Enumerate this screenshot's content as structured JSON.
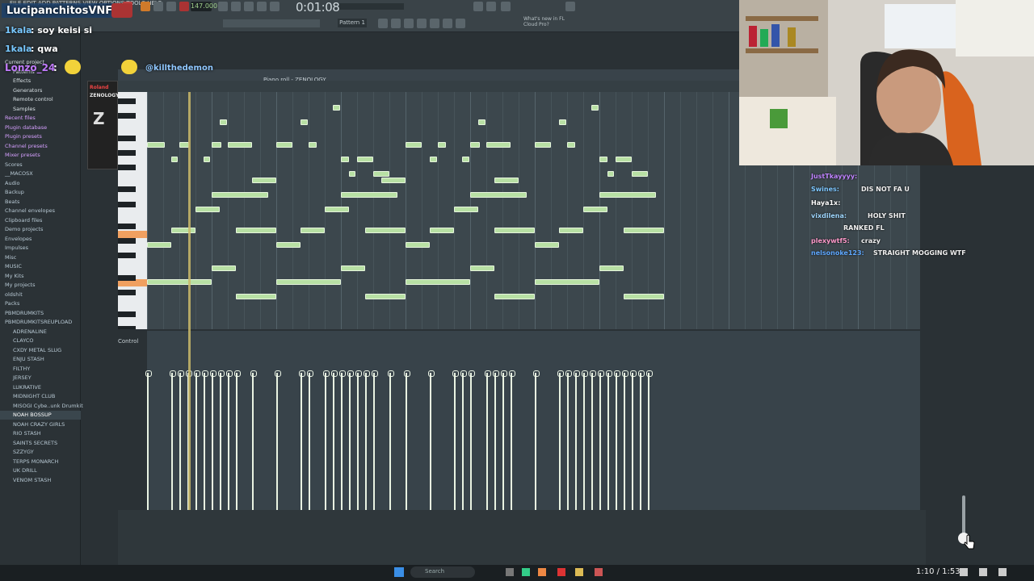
{
  "stream": {
    "streamer_label": "LucipanchitosVNF :",
    "chat_top": [
      {
        "user": "1kala",
        "message": ": soy keisi si"
      },
      {
        "user": "1kala",
        "message": ": qwa"
      },
      {
        "user": "Lonzo_24",
        "message": ":"
      }
    ],
    "mention": "@killthedemon",
    "chat_right": [
      {
        "user": "JustTkayyyy:",
        "message": ""
      },
      {
        "user": "Swines:",
        "message": "DIS NOT FA U"
      },
      {
        "user": "Haya1x:",
        "message": ""
      },
      {
        "user": "vixdilena:",
        "message": "HOLY SHIT"
      },
      {
        "user": "",
        "message": "RANKED FL"
      },
      {
        "user": "plexywtf5:",
        "message": "crazy"
      },
      {
        "user": "nelsonoke123:",
        "message": "STRAIGHT MOGGING WTF"
      }
    ],
    "video_time": "1:10 / 1:53"
  },
  "toolbar": {
    "tempo": "147.000",
    "time": "0:01:08",
    "pattern": "Pattern 1",
    "news": "What's new in FL Cloud Pro?"
  },
  "browser": {
    "items": [
      "Current project",
      "Patterns",
      "Effects",
      "Generators",
      "Remote control",
      "Samples",
      "Recent files",
      "Plugin database",
      "Plugin presets",
      "Channel presets",
      "Mixer presets",
      "Scores",
      "__MACOSX",
      "Audio",
      "Backup",
      "Beats",
      "Channel envelopes",
      "Clipboard files",
      "Demo projects",
      "Envelopes",
      "Impulses",
      "Misc",
      "MUSIC",
      "My Kits",
      "My projects",
      "oldshit",
      "Packs",
      "PBMDRUMKITS",
      "PBMDRUMKITSREUPLOAD",
      "ADRENALINE",
      "CLAYCO",
      "CXDY METAL SLUG",
      "ENJU STASH",
      "FILTHY",
      "JERSEY",
      "LUKRATIVE",
      "MIDNIGHT CLUB",
      "MISOGI Cybe..unk Drumkit",
      "NOAH BOSSUP",
      "NOAH CRAZY GIRLS",
      "RIO STASH",
      "SAINTS SECRETS",
      "SZZYGY",
      "TERPS MONARCH",
      "UK DRILL",
      "VENOM STASH"
    ],
    "selected": "NOAH BOSSUP"
  },
  "piano_roll": {
    "title": "Piano roll - ZENOLOGY",
    "plugin": "ZENOLOGY",
    "control_label": "Control"
  },
  "colors": {
    "note": "#b8e0a4",
    "accent_key": "#f0a060",
    "playhead": "#c9b96a"
  },
  "icons": [
    "play-icon",
    "stop-icon",
    "record-icon",
    "pattern-icon",
    "search-icon",
    "windows-icon",
    "slider-knob"
  ]
}
